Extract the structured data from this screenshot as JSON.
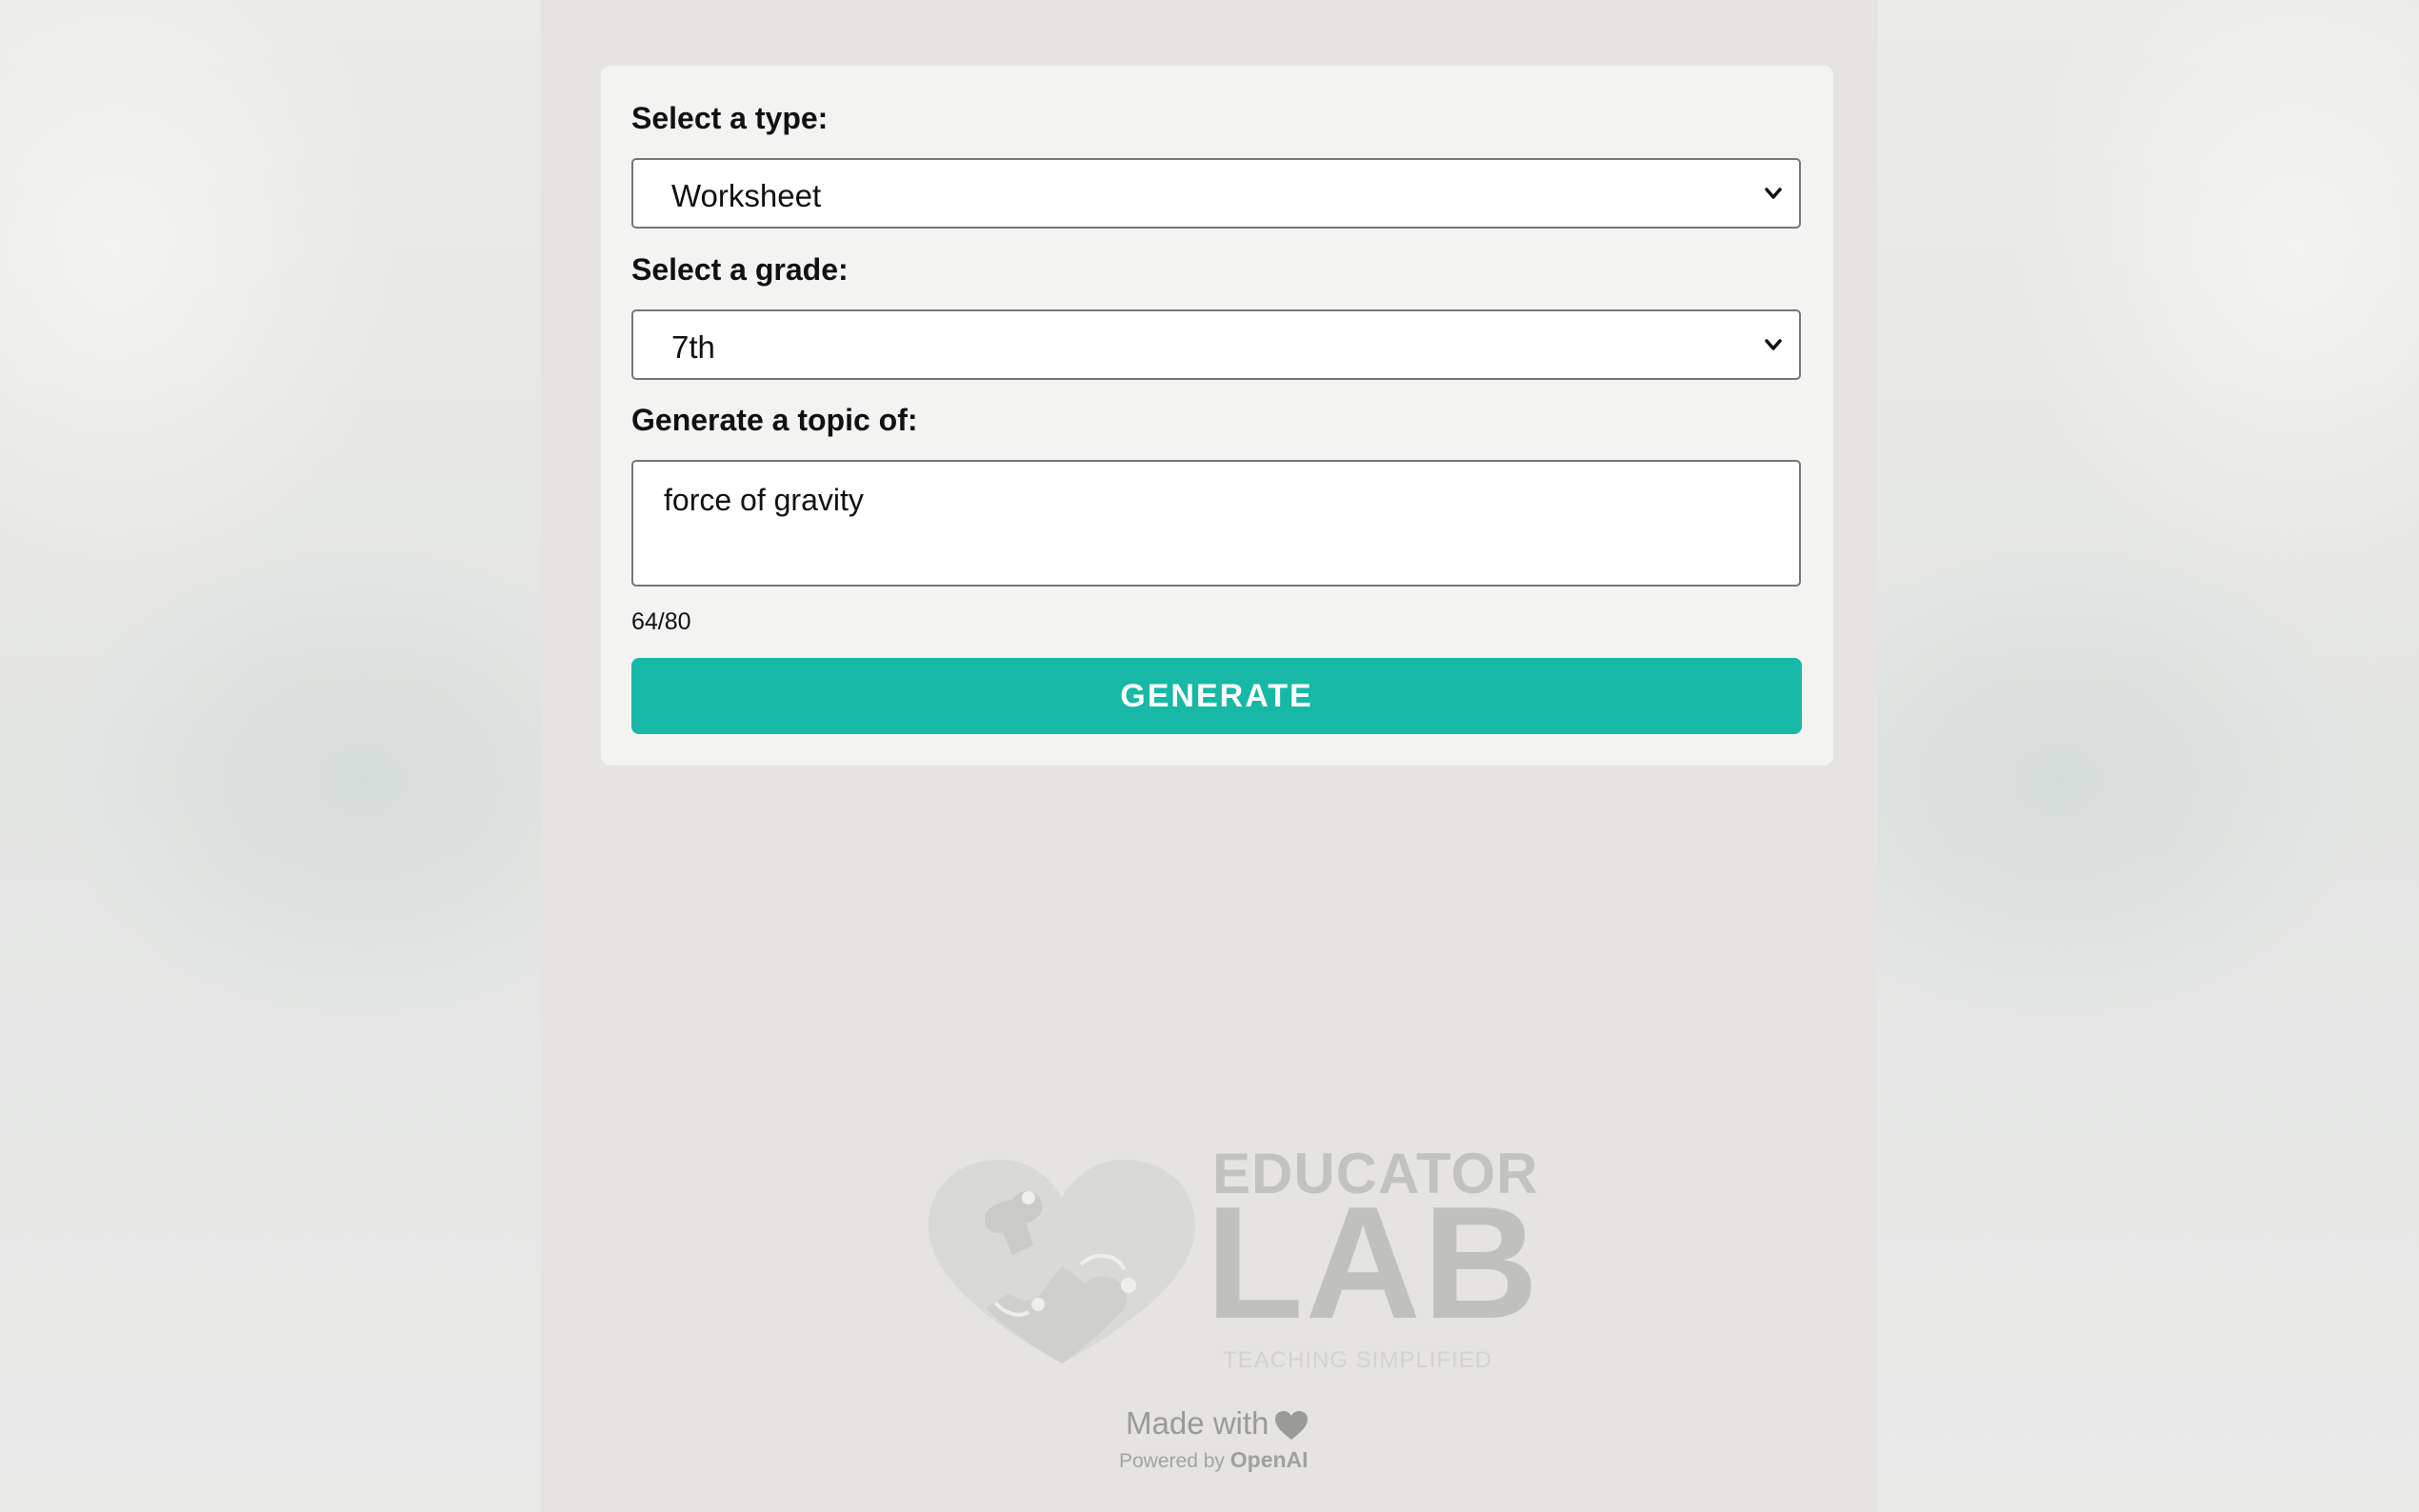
{
  "form": {
    "type_label": "Select a type:",
    "type_value": "Worksheet",
    "grade_label": "Select a grade:",
    "grade_value": "7th",
    "topic_label": "Generate a topic of:",
    "topic_value": "force of gravity",
    "char_counter": "64/80",
    "generate_label": "GENERATE"
  },
  "logo": {
    "line1": "EDUCATOR",
    "line2": "LAB",
    "tagline": "TEACHING SIMPLIFIED"
  },
  "footer": {
    "made_with": "Made with",
    "powered_by": "Powered by",
    "powered_brand": "OpenAI"
  },
  "icons": {
    "select_chevron": "chevron-down-icon",
    "footer_heart": "heart-icon",
    "logo_mark": "heart-puzzle-icon"
  },
  "colors": {
    "accent": "#17b8a6",
    "background": "#e5e4e2",
    "card": "#f3f3f2"
  }
}
